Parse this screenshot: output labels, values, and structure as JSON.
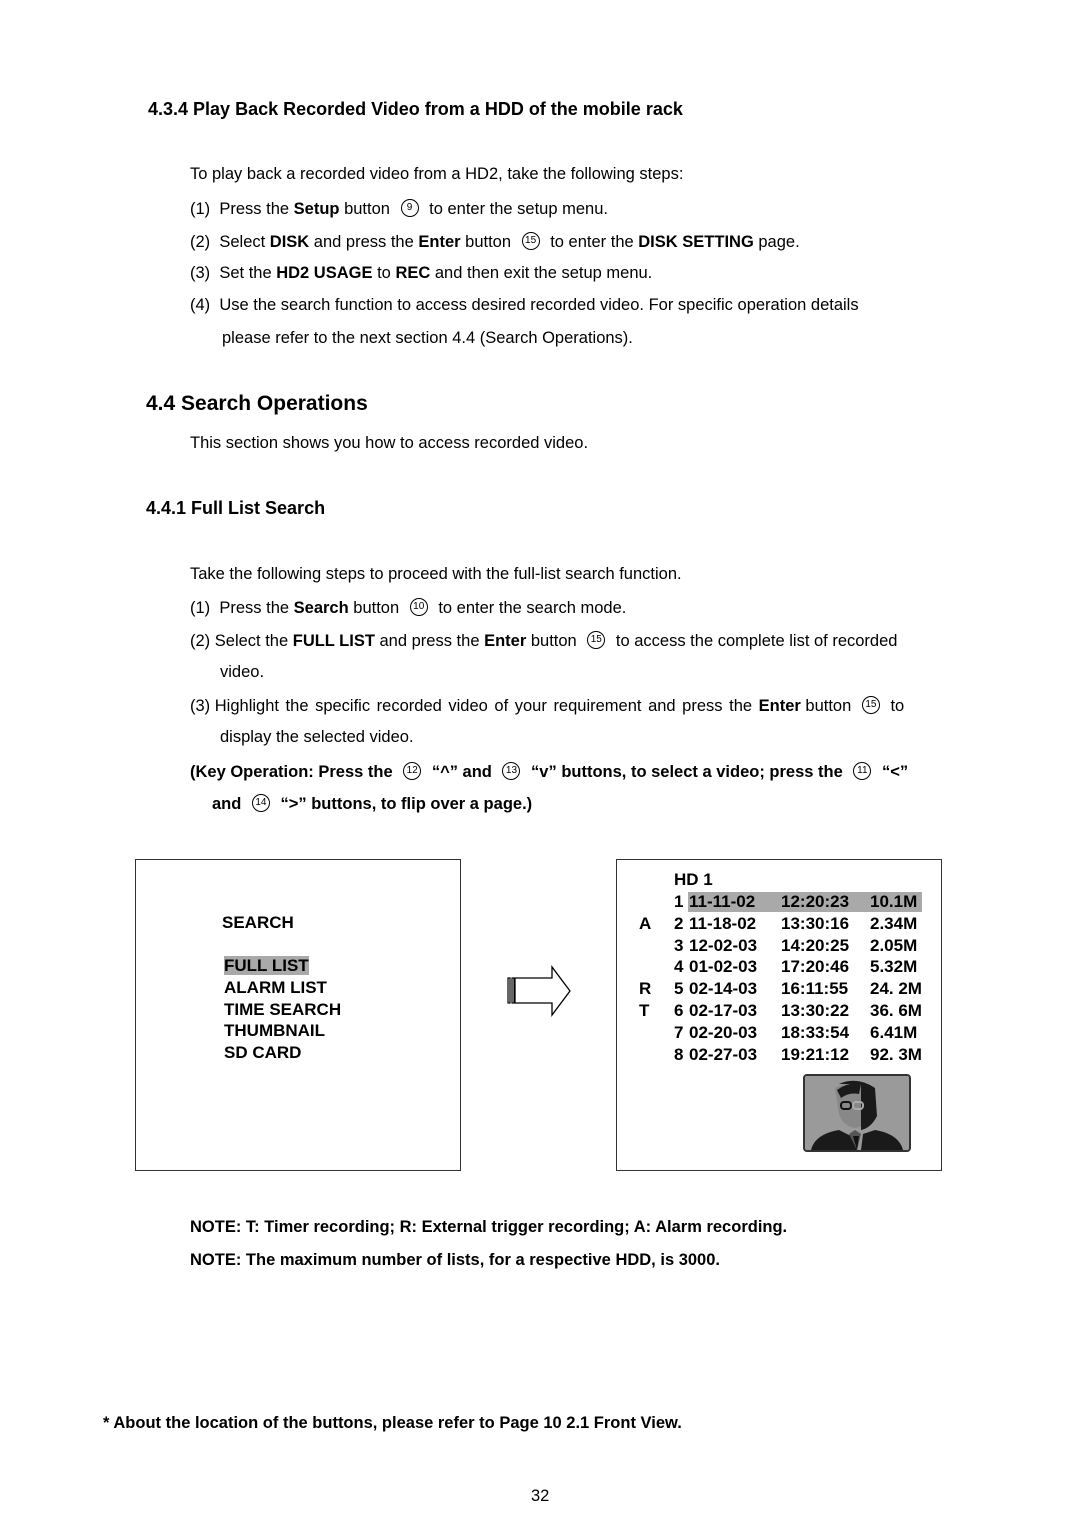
{
  "section_434": {
    "heading": "4.3.4 Play Back Recorded Video from a HDD of the mobile rack",
    "intro": "To play back a recorded video from a HD2, take the following steps:",
    "steps": [
      {
        "num": "(1)",
        "pre": "Press the ",
        "bold1": "Setup",
        "mid1": " button ",
        "icon": "9",
        "post": " to enter the setup menu."
      },
      {
        "num": "(2)",
        "pre": "Select ",
        "bold1": "DISK",
        "mid1": " and press the ",
        "bold2": "Enter",
        "mid2": " button ",
        "icon": "15",
        "mid3": " to enter the ",
        "bold3": "DISK SETTING",
        "post": " page."
      },
      {
        "num": "(3)",
        "pre": "Set the ",
        "bold1": "HD2 USAGE",
        "mid1": " to ",
        "bold2": "REC",
        "post": " and then exit the setup menu."
      },
      {
        "num": "(4)",
        "line1": "Use the search function to access desired recorded video. For specific operation details",
        "line2": "please refer to the next section 4.4 (Search Operations)."
      }
    ]
  },
  "section_44": {
    "heading": "4.4 Search Operations",
    "intro": "This section shows you how to access recorded video."
  },
  "section_441": {
    "heading": "4.4.1 Full List Search",
    "intro": "Take the following steps to proceed with the full-list search function.",
    "step1": {
      "num": "(1)",
      "pre": "Press the ",
      "bold": "Search",
      "mid": " button ",
      "icon": "10",
      "post": " to enter the search mode."
    },
    "step2": {
      "num": "(2)",
      "pre": "Select the ",
      "bold1": "FULL LIST",
      "mid1": " and press the ",
      "bold2": "Enter",
      "mid2": " button ",
      "icon": "15",
      "post": " to access the complete list of recorded",
      "line2": "video."
    },
    "step3": {
      "num": "(3)",
      "pre": "Highlight the specific recorded video of your requirement and press the ",
      "bold": "Enter",
      "mid": " button ",
      "icon": "15",
      "post": " to",
      "line2": "display the selected video."
    },
    "key_op": {
      "p1": "(Key Operation: Press the ",
      "icon1": "12",
      "p2": " “^” and ",
      "icon2": "13",
      "p3": " “v” buttons, to select a video; press the ",
      "icon3": "11",
      "p4": " “<”",
      "p5": "and ",
      "icon4": "14",
      "p6": " “>” buttons, to flip over a page.)"
    }
  },
  "search_menu": {
    "title": "SEARCH",
    "items": [
      "FULL LIST",
      "ALARM LIST",
      "TIME SEARCH",
      "THUMBNAIL",
      "SD CARD"
    ],
    "selected": "FULL LIST"
  },
  "full_list": {
    "title": "HD 1",
    "rows": [
      {
        "type": "",
        "num": "1",
        "date": "11-11-02",
        "time": "12:20:23",
        "size": "10.1M",
        "selected": true
      },
      {
        "type": "A",
        "num": "2",
        "date": "11-18-02",
        "time": "13:30:16",
        "size": "2.34M"
      },
      {
        "type": "",
        "num": "3",
        "date": "12-02-03",
        "time": "14:20:25",
        "size": "2.05M"
      },
      {
        "type": "",
        "num": "4",
        "date": "01-02-03",
        "time": "17:20:46",
        "size": "5.32M"
      },
      {
        "type": "R",
        "num": "5",
        "date": "02-14-03",
        "time": "16:11:55",
        "size": "24. 2M"
      },
      {
        "type": "T",
        "num": "6",
        "date": "02-17-03",
        "time": "13:30:22",
        "size": "36. 6M"
      },
      {
        "type": "",
        "num": "7",
        "date": "02-20-03",
        "time": "18:33:54",
        "size": "6.41M"
      },
      {
        "type": "",
        "num": "8",
        "date": "02-27-03",
        "time": "19:21:12",
        "size": "92. 3M"
      }
    ],
    "highlight_color": "#a9a9a9"
  },
  "notes": [
    "NOTE: T: Timer recording; R: External trigger recording; A: Alarm recording.",
    "NOTE: The maximum number of lists, for a respective HDD, is 3000."
  ],
  "footnote": "* About the location of the buttons, please refer to Page 10 2.1 Front View.",
  "page_number": "32"
}
